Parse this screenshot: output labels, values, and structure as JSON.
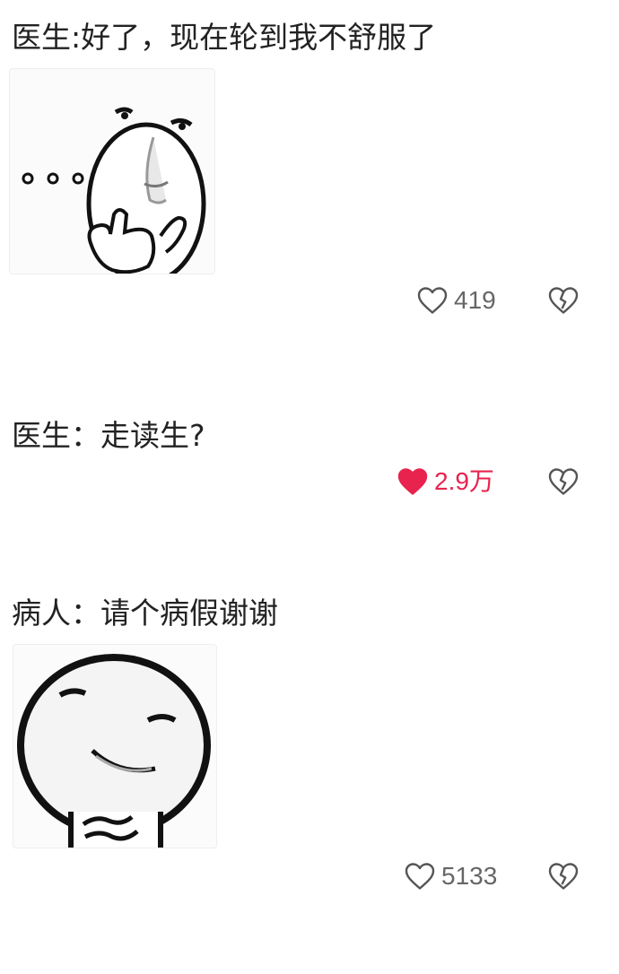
{
  "comments": [
    {
      "text": "医生:好了，现在轮到我不舒服了",
      "has_sticker": true,
      "sticker_icon": "pondering-face-sticker",
      "likes": "419",
      "liked": false
    },
    {
      "text": "医生：走读生?",
      "has_sticker": false,
      "likes": "2.9万",
      "liked": true
    },
    {
      "text": "病人：请个病假谢谢",
      "has_sticker": true,
      "sticker_icon": "smirking-face-sticker",
      "likes": "5133",
      "liked": false
    }
  ],
  "icons": {
    "like": "heart-outline-icon",
    "liked": "heart-filled-icon",
    "dislike": "broken-heart-icon"
  },
  "colors": {
    "liked": "#e8234e",
    "text": "#222222",
    "count": "#666666",
    "icon": "#555555"
  }
}
